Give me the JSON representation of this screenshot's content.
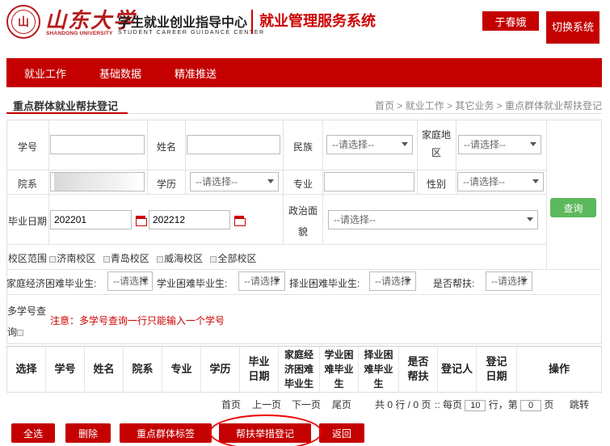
{
  "header": {
    "university_cn": "山东大学",
    "university_en": "SHANDONG UNIVERSITY",
    "center_cn": "学生就业创业指导中心",
    "center_en": "STUDENT CAREER GUIDANCE CENTER",
    "system_title": "就业管理服务系统",
    "user_name": "于春娥",
    "switch_system": "切换系统"
  },
  "nav": [
    "就业工作",
    "基础数据",
    "精准推送"
  ],
  "page": {
    "section_title": "重点群体就业帮扶登记",
    "breadcrumb": "首页 > 就业工作 > 其它业务 > 重点群体就业帮扶登记"
  },
  "form": {
    "labels": {
      "student_id": "学号",
      "name": "姓名",
      "ethnicity": "民族",
      "family_area": "家庭地区",
      "department": "院系",
      "education": "学历",
      "major": "专业",
      "gender": "性别",
      "graduation_date": "毕业日期",
      "political_status": "政治面貌",
      "campus_scope": "校区范围",
      "economic_hardship": "家庭经济困难毕业生:",
      "study_hardship": "学业困难毕业生:",
      "employment_hardship": "择业困难毕业生:",
      "is_assisted": "是否帮扶:",
      "multi_id_query": "多学号查询"
    },
    "select_placeholder": "--请选择--",
    "select_placeholder_short": "--请选择",
    "graduation_from": "202201",
    "graduation_to": "202212",
    "campus_options": [
      "济南校区",
      "青岛校区",
      "威海校区",
      "全部校区"
    ],
    "notice": "注意：多学号查询一行只能输入一个学号",
    "query_button": "查询"
  },
  "table": {
    "columns": [
      "选择",
      "学号",
      "姓名",
      "院系",
      "专业",
      "学历",
      "毕业日期",
      "家庭经济困难毕业生",
      "学业困难毕业生",
      "择业困难毕业生",
      "是否帮扶",
      "登记人",
      "登记日期",
      "操作"
    ]
  },
  "pager": {
    "first": "首页",
    "prev": "上一页",
    "next": "下一页",
    "last": "尾页",
    "summary": "共 0 行 / 0 页",
    "per_page_prefix": ":: 每页",
    "per_page_value": "10",
    "per_page_suffix": "行，第",
    "page_value": "0",
    "page_suffix": "页",
    "jump": "跳转"
  },
  "actions": {
    "select_all": "全选",
    "delete": "删除",
    "tag": "重点群体标签",
    "register": "帮扶举措登记",
    "back": "返回"
  },
  "colors": {
    "brand_red": "#c40000",
    "query_green": "#5cb85c",
    "notice_red": "#cc0000"
  }
}
